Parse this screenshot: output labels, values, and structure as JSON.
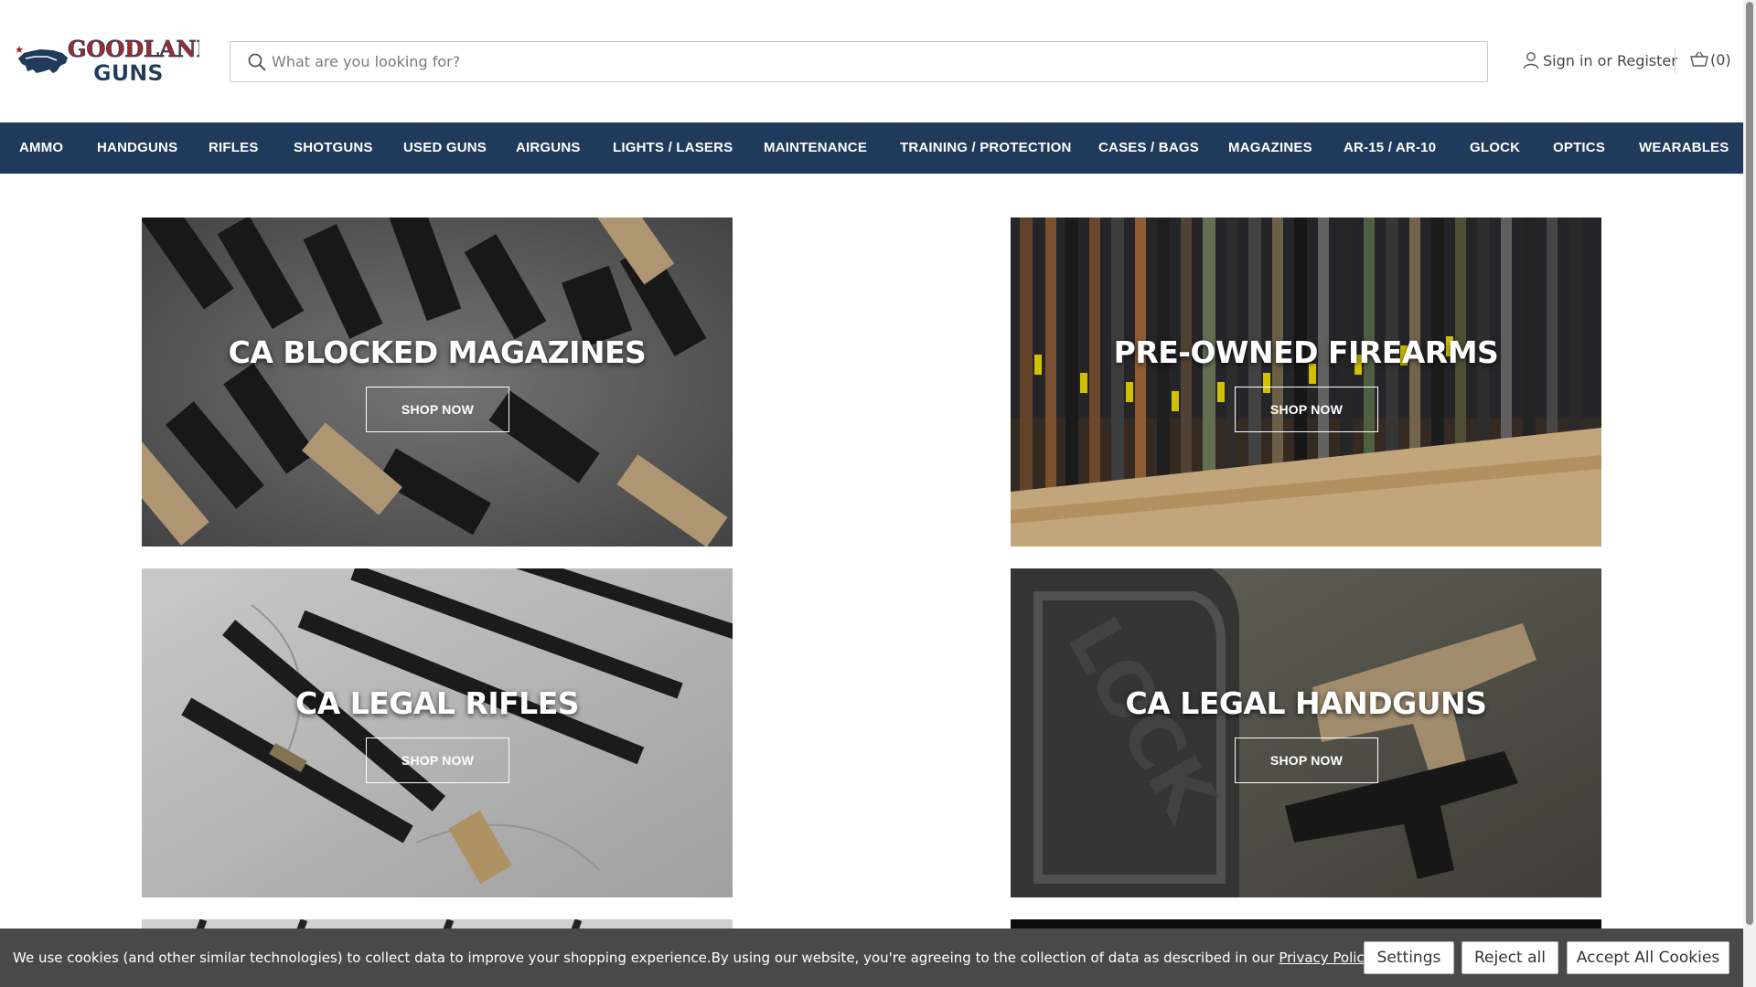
{
  "header": {
    "logo_alt": "Goodland Guns",
    "search_placeholder": "What are you looking for?",
    "sign_in": "Sign in",
    "or": "or",
    "register": "Register",
    "cart_count": "(0)"
  },
  "nav": {
    "items": [
      "AMMO",
      "HANDGUNS",
      "RIFLES",
      "SHOTGUNS",
      "USED GUNS",
      "AIRGUNS",
      "LIGHTS / LASERS",
      "MAINTENANCE",
      "TRAINING / PROTECTION",
      "CASES / BAGS",
      "MAGAZINES",
      "AR-15 / AR-10",
      "GLOCK",
      "OPTICS",
      "WEARABLES"
    ]
  },
  "banners": [
    {
      "title": "CA BLOCKED MAGAZINES",
      "button": "SHOP NOW"
    },
    {
      "title": "PRE-OWNED FIREARMS",
      "button": "SHOP NOW"
    },
    {
      "title": "CA LEGAL RIFLES",
      "button": "SHOP NOW"
    },
    {
      "title": "CA LEGAL HANDGUNS",
      "button": "SHOP NOW"
    }
  ],
  "cookie": {
    "message": "We use cookies (and other similar technologies) to collect data to improve your shopping experience.By using our website, you're agreeing to the collection of data as described in our ",
    "policy_link": "Privacy Policy",
    "period": ".",
    "settings": "Settings",
    "reject": "Reject all",
    "accept": "Accept All Cookies"
  },
  "colors": {
    "nav_bg": "#1f3a5b",
    "logo_red": "#a52a2a",
    "logo_navy": "#1f3a5b",
    "cookie_bg": "#494949"
  }
}
